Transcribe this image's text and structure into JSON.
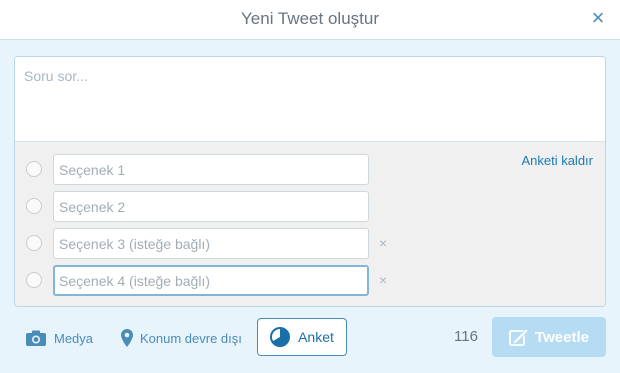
{
  "dialog": {
    "title": "Yeni Tweet oluştur",
    "close_glyph": "×"
  },
  "composer": {
    "question_placeholder": "Soru sor..."
  },
  "poll": {
    "remove_label": "Anketi kaldır",
    "remove_glyph": "×",
    "options": [
      {
        "placeholder": "Seçenek 1",
        "removable": false,
        "focused": false
      },
      {
        "placeholder": "Seçenek 2",
        "removable": false,
        "focused": false
      },
      {
        "placeholder": "Seçenek 3 (isteğe bağlı)",
        "removable": true,
        "focused": false
      },
      {
        "placeholder": "Seçenek 4 (isteğe bağlı)",
        "removable": true,
        "focused": true
      }
    ]
  },
  "toolbar": {
    "media_label": "Medya",
    "media_icon": "camera-icon",
    "location_label": "Konum devre dışı",
    "location_icon": "location-pin-icon",
    "poll_label": "Anket",
    "poll_icon": "pie-chart-icon",
    "char_count": "116",
    "tweet_label": "Tweetle",
    "tweet_icon": "compose-quill-icon"
  },
  "colors": {
    "accent": "#4a8cb8",
    "link": "#1b7bb5",
    "tweet_button_disabled": "#b5dcf3",
    "background": "#e8f4fb"
  }
}
